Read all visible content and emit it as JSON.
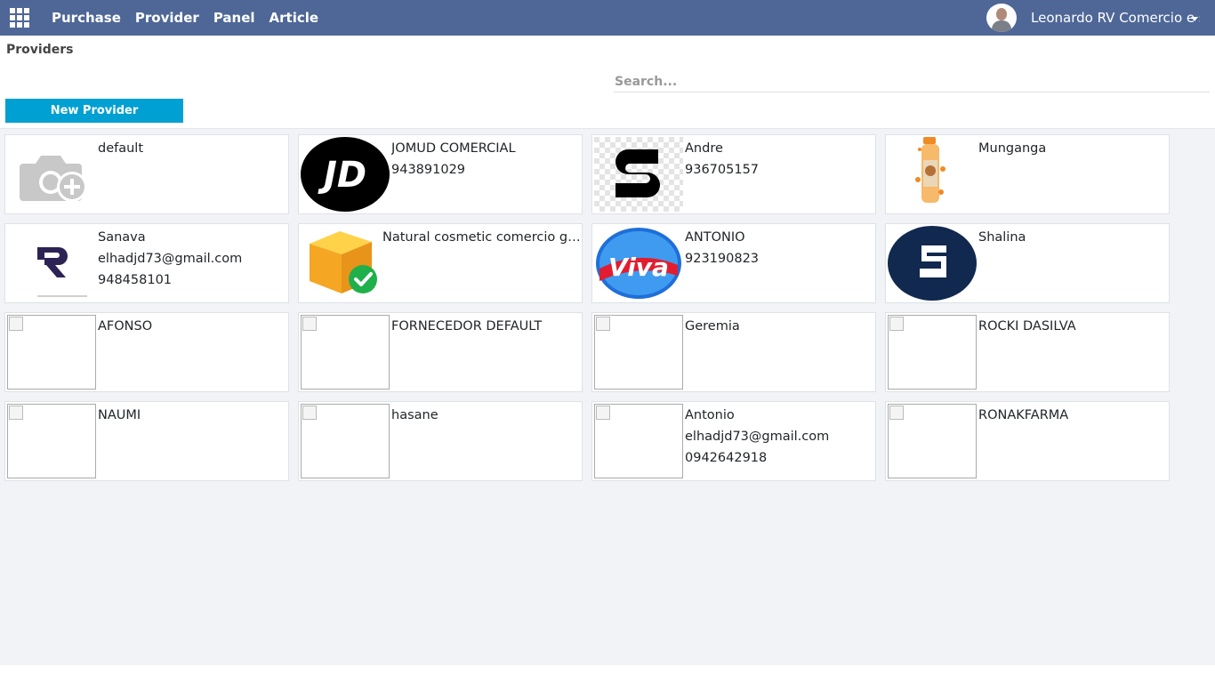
{
  "navbar": {
    "menu": [
      "Purchase",
      "Provider",
      "Panel",
      "Article"
    ],
    "user_name": "Leonardo RV Comercio e s"
  },
  "page": {
    "title": "Providers",
    "search_placeholder": "Search...",
    "new_button": "New Provider"
  },
  "providers": [
    {
      "name": "default",
      "lines": [],
      "icon": "camera-plus-icon"
    },
    {
      "name": "JOMUD COMERCIAL",
      "lines": [
        "943891029"
      ],
      "icon": "jd-logo-icon"
    },
    {
      "name": "Andre",
      "lines": [
        "936705157"
      ],
      "icon": "s-logo-icon"
    },
    {
      "name": "Munganga",
      "lines": [],
      "icon": "cosmetic-bottle-icon"
    },
    {
      "name": "Sanava",
      "lines": [
        "elhadjd73@gmail.com",
        "948458101"
      ],
      "icon": "r-logo-icon"
    },
    {
      "name": "Natural cosmetic comercio ge...",
      "lines": [],
      "icon": "package-check-icon"
    },
    {
      "name": "ANTONIO",
      "lines": [
        "923190823"
      ],
      "icon": "viva-logo-icon"
    },
    {
      "name": "Shalina",
      "lines": [],
      "icon": "shalina-logo-icon"
    },
    {
      "name": "AFONSO",
      "lines": [],
      "icon": "broken-image-icon"
    },
    {
      "name": "FORNECEDOR DEFAULT",
      "lines": [],
      "icon": "broken-image-icon"
    },
    {
      "name": "Geremia",
      "lines": [],
      "icon": "broken-image-icon"
    },
    {
      "name": "ROCKI DASILVA",
      "lines": [],
      "icon": "broken-image-icon"
    },
    {
      "name": "NAUMI",
      "lines": [],
      "icon": "broken-image-icon"
    },
    {
      "name": "hasane",
      "lines": [],
      "icon": "broken-image-icon"
    },
    {
      "name": "Antonio",
      "lines": [
        "elhadjd73@gmail.com",
        "0942642918"
      ],
      "icon": "broken-image-icon"
    },
    {
      "name": "RONAKFARMA",
      "lines": [],
      "icon": "broken-image-icon"
    }
  ],
  "colors": {
    "navbar": "#4e6797",
    "primary_button": "#00a0d2",
    "background": "#f1f3f7"
  }
}
